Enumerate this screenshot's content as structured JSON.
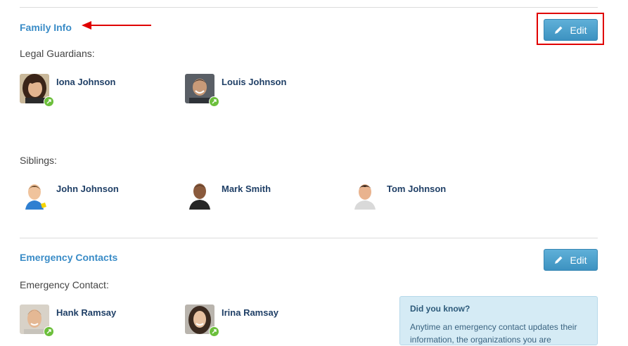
{
  "colors": {
    "accent": "#3a8cc7",
    "button": "#4ea3cf",
    "name": "#1f3f66",
    "highlight": "#e00000",
    "badge": "#6cbf3c",
    "info_bg": "#d5ebf5"
  },
  "family_info": {
    "title": "Family Info",
    "edit_label": "Edit",
    "guardians_label": "Legal Guardians:",
    "guardians": [
      {
        "name": "Iona Johnson",
        "icon": "link-badge-icon"
      },
      {
        "name": "Louis Johnson",
        "icon": "link-badge-icon"
      }
    ],
    "siblings_label": "Siblings:",
    "siblings": [
      {
        "name": "John Johnson"
      },
      {
        "name": "Mark Smith"
      },
      {
        "name": "Tom Johnson"
      }
    ]
  },
  "emergency": {
    "title": "Emergency Contacts",
    "edit_label": "Edit",
    "contact_label": "Emergency Contact:",
    "contacts": [
      {
        "name": "Hank Ramsay",
        "icon": "link-badge-icon"
      },
      {
        "name": "Irina Ramsay",
        "icon": "link-badge-icon"
      }
    ],
    "info": {
      "title": "Did you know?",
      "text": "Anytime an emergency contact updates their information, the organizations you are"
    }
  },
  "annotations": {
    "arrow_icon": "red-arrow-icon"
  }
}
